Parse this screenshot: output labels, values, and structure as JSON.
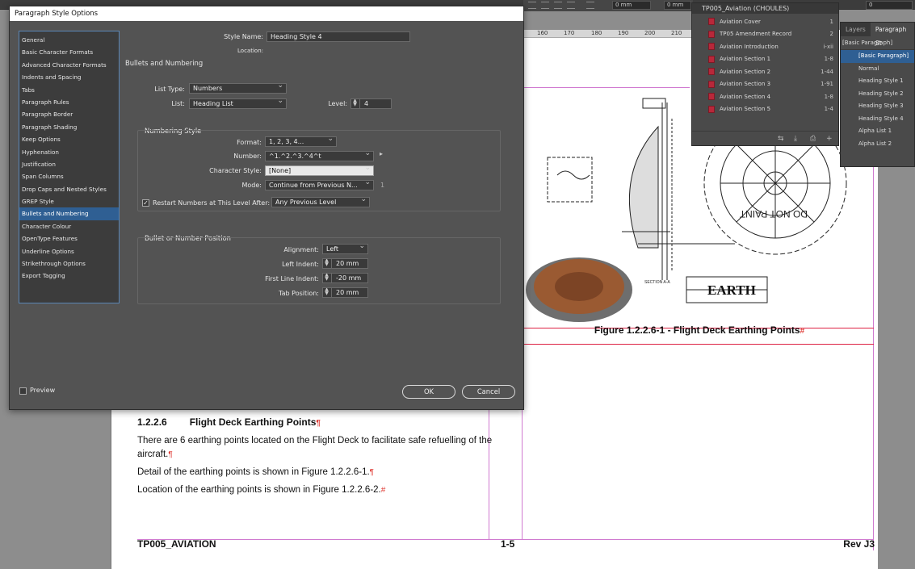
{
  "dialog": {
    "title": "Paragraph Style Options",
    "categories": [
      "General",
      "Basic Character Formats",
      "Advanced Character Formats",
      "Indents and Spacing",
      "Tabs",
      "Paragraph Rules",
      "Paragraph Border",
      "Paragraph Shading",
      "Keep Options",
      "Hyphenation",
      "Justification",
      "Span Columns",
      "Drop Caps and Nested Styles",
      "GREP Style",
      "Bullets and Numbering",
      "Character Colour",
      "OpenType Features",
      "Underline Options",
      "Strikethrough Options",
      "Export Tagging"
    ],
    "selected_category": "Bullets and Numbering",
    "style_name_label": "Style Name:",
    "style_name": "Heading Style 4",
    "location_label": "Location:",
    "section_title": "Bullets and Numbering",
    "list_type_label": "List Type:",
    "list_type": "Numbers",
    "list_label": "List:",
    "list": "Heading List",
    "level_label": "Level:",
    "level": "4",
    "numbering_style": {
      "title": "Numbering Style",
      "format_label": "Format:",
      "format": "1, 2, 3, 4...",
      "number_label": "Number:",
      "number": "^1.^2.^3.^4^t",
      "char_style_label": "Character Style:",
      "char_style": "[None]",
      "mode_label": "Mode:",
      "mode": "Continue from Previous N...",
      "mode_value": "1",
      "restart_checked": true,
      "restart_label": "Restart Numbers at This Level After:",
      "restart_after": "Any Previous Level"
    },
    "position": {
      "title": "Bullet or Number Position",
      "alignment_label": "Alignment:",
      "alignment": "Left",
      "left_indent_label": "Left Indent:",
      "left_indent": "20 mm",
      "first_line_label": "First Line Indent:",
      "first_line": "-20 mm",
      "tab_position_label": "Tab Position:",
      "tab_position": "20 mm"
    },
    "preview_label": "Preview",
    "preview_checked": false,
    "ok_label": "OK",
    "cancel_label": "Cancel"
  },
  "book_panel": {
    "title": "TP005_Aviation (CHOULES)",
    "items": [
      {
        "name": "Aviation Cover",
        "pages": "1"
      },
      {
        "name": "TP05 Amendment Record",
        "pages": "2"
      },
      {
        "name": "Aviation Introduction",
        "pages": "i-xii"
      },
      {
        "name": "Aviation Section 1",
        "pages": "1-8"
      },
      {
        "name": "Aviation Section 2",
        "pages": "1-44"
      },
      {
        "name": "Aviation Section 3",
        "pages": "1-91"
      },
      {
        "name": "Aviation Section 4",
        "pages": "1-8"
      },
      {
        "name": "Aviation Section 5",
        "pages": "1-4"
      }
    ]
  },
  "para_panel": {
    "tab_layers": "Layers",
    "tab_paragraph": "Paragraph St",
    "current": "[Basic Paragraph]",
    "styles": [
      "[Basic Paragraph]",
      "Normal",
      "Heading Style 1",
      "Heading Style 2",
      "Heading Style 3",
      "Heading Style 4",
      "Alpha List 1",
      "Alpha List 2"
    ],
    "selected": "[Basic Paragraph]"
  },
  "control_bar": {
    "field_a": "0 mm",
    "field_b": "0 mm",
    "field_c": "0"
  },
  "ruler": {
    "labels": [
      "160",
      "170",
      "180",
      "190",
      "200",
      "210"
    ]
  },
  "document": {
    "figure_caption": "Figure 1.2.2.6-1 - Flight Deck Earthing Points",
    "figure_labels": {
      "earth": "EARTH",
      "do_not_paint": "DO NOT PAINT",
      "section_a": "SECTION A-A"
    },
    "heading_number": "1.2.2.6",
    "heading_text": "Flight Deck Earthing Points",
    "paragraphs": [
      "There are 6 earthing points located on the Flight Deck to facilitate safe refuelling of the aircraft.",
      "Detail of the earthing points is shown in Figure 1.2.2.6-1.",
      "Location of the earthing points is shown in Figure 1.2.2.6-2."
    ],
    "footer_left": "TP005_AVIATION",
    "footer_mid": "1-5",
    "footer_right": "Rev J3"
  }
}
